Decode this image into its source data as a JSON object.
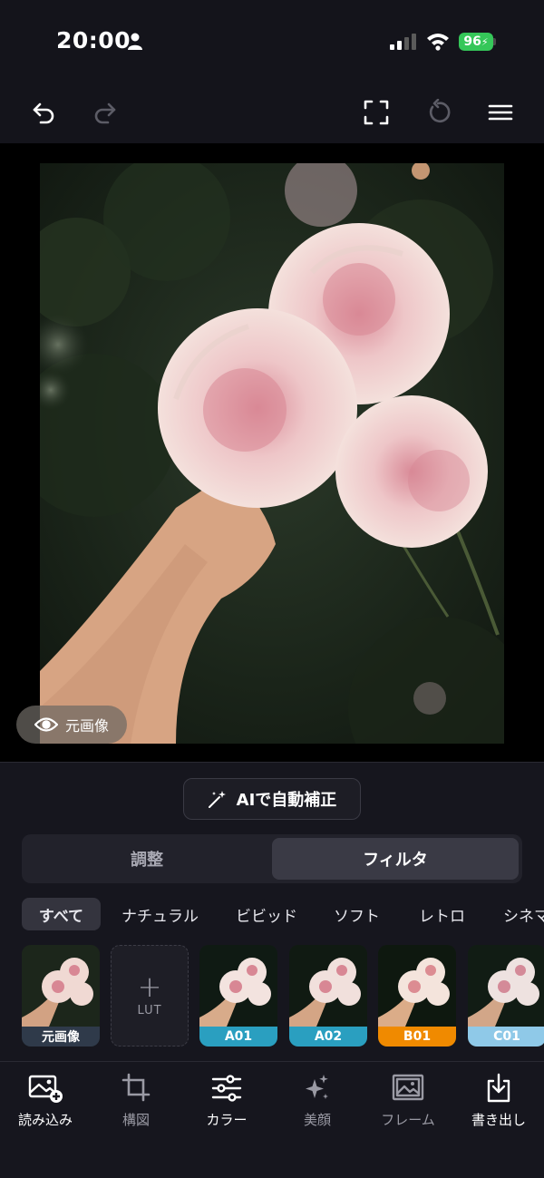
{
  "status_bar": {
    "time": "20:00",
    "battery": "96",
    "icons": [
      "person-icon",
      "signal-icon",
      "wifi-icon",
      "battery-icon"
    ]
  },
  "toolbar": {
    "icons": [
      "undo-icon",
      "redo-icon",
      "fullscreen-icon",
      "reset-icon",
      "menu-icon"
    ]
  },
  "photo": {
    "original_button_label": "元画像"
  },
  "ai_button_label": "AIで自動補正",
  "segments": {
    "adjust": "調整",
    "filter": "フィルタ",
    "selected": "filter"
  },
  "categories": [
    "すべて",
    "ナチュラル",
    "ビビッド",
    "ソフト",
    "レトロ",
    "シネマ"
  ],
  "thumbnails": [
    {
      "label": "元画像",
      "color": "#2f3a4a"
    },
    {
      "label": "A01",
      "color": "#2a9fc0"
    },
    {
      "label": "A02",
      "color": "#2a9fc0"
    },
    {
      "label": "B01",
      "color": "#f08a00"
    },
    {
      "label": "C01",
      "color": "#8fc9e8"
    }
  ],
  "lut_label": "LUT",
  "bottom_nav": [
    {
      "label": "読み込み",
      "icon": "import-image-icon"
    },
    {
      "label": "構図",
      "icon": "crop-icon"
    },
    {
      "label": "カラー",
      "icon": "sliders-icon"
    },
    {
      "label": "美顔",
      "icon": "sparkle-icon"
    },
    {
      "label": "フレーム",
      "icon": "frame-icon"
    },
    {
      "label": "書き出し",
      "icon": "export-icon"
    }
  ],
  "colors": {
    "background": "#14141b",
    "battery": "#35c759",
    "accent_blue": "#2a9fc0",
    "accent_orange": "#f08a00"
  }
}
